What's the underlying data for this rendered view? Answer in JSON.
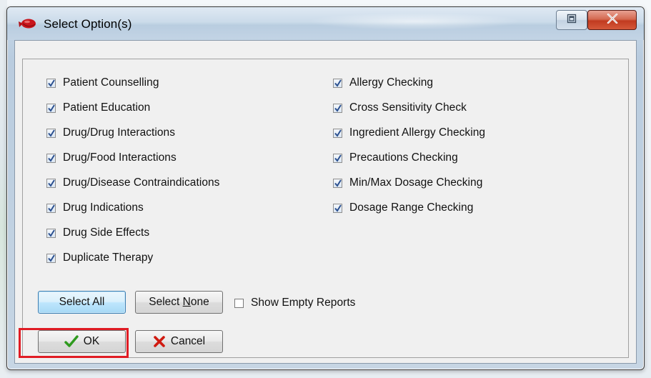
{
  "window": {
    "title": "Select Option(s)",
    "icons": {
      "app": "pill-icon",
      "restore": "restore-icon",
      "close": "close-icon"
    },
    "close_label": "X"
  },
  "options_left": [
    {
      "label": "Patient Counselling",
      "checked": true
    },
    {
      "label": "Patient Education",
      "checked": true
    },
    {
      "label": "Drug/Drug Interactions",
      "checked": true
    },
    {
      "label": "Drug/Food Interactions",
      "checked": true
    },
    {
      "label": "Drug/Disease Contraindications",
      "checked": true
    },
    {
      "label": "Drug Indications",
      "checked": true
    },
    {
      "label": "Drug Side Effects",
      "checked": true
    },
    {
      "label": "Duplicate Therapy",
      "checked": true
    }
  ],
  "options_right": [
    {
      "label": "Allergy Checking",
      "checked": true
    },
    {
      "label": "Cross Sensitivity Check",
      "checked": true
    },
    {
      "label": "Ingredient Allergy Checking",
      "checked": true
    },
    {
      "label": "Precautions Checking",
      "checked": true
    },
    {
      "label": "Min/Max Dosage Checking",
      "checked": true
    },
    {
      "label": "Dosage Range Checking",
      "checked": true
    }
  ],
  "controls": {
    "select_all_label": "Select All",
    "select_none_prefix": "Select ",
    "select_none_mnemonic": "N",
    "select_none_suffix": "one",
    "show_empty_reports_label": "Show Empty Reports",
    "show_empty_reports_checked": false
  },
  "actions": {
    "ok_label": "OK",
    "cancel_label": "Cancel",
    "ok_icon": "checkmark-icon",
    "cancel_icon": "x-icon"
  },
  "colors": {
    "highlight": "#e01c24",
    "check_green": "#2e9a1e",
    "cancel_red": "#d01a10"
  }
}
